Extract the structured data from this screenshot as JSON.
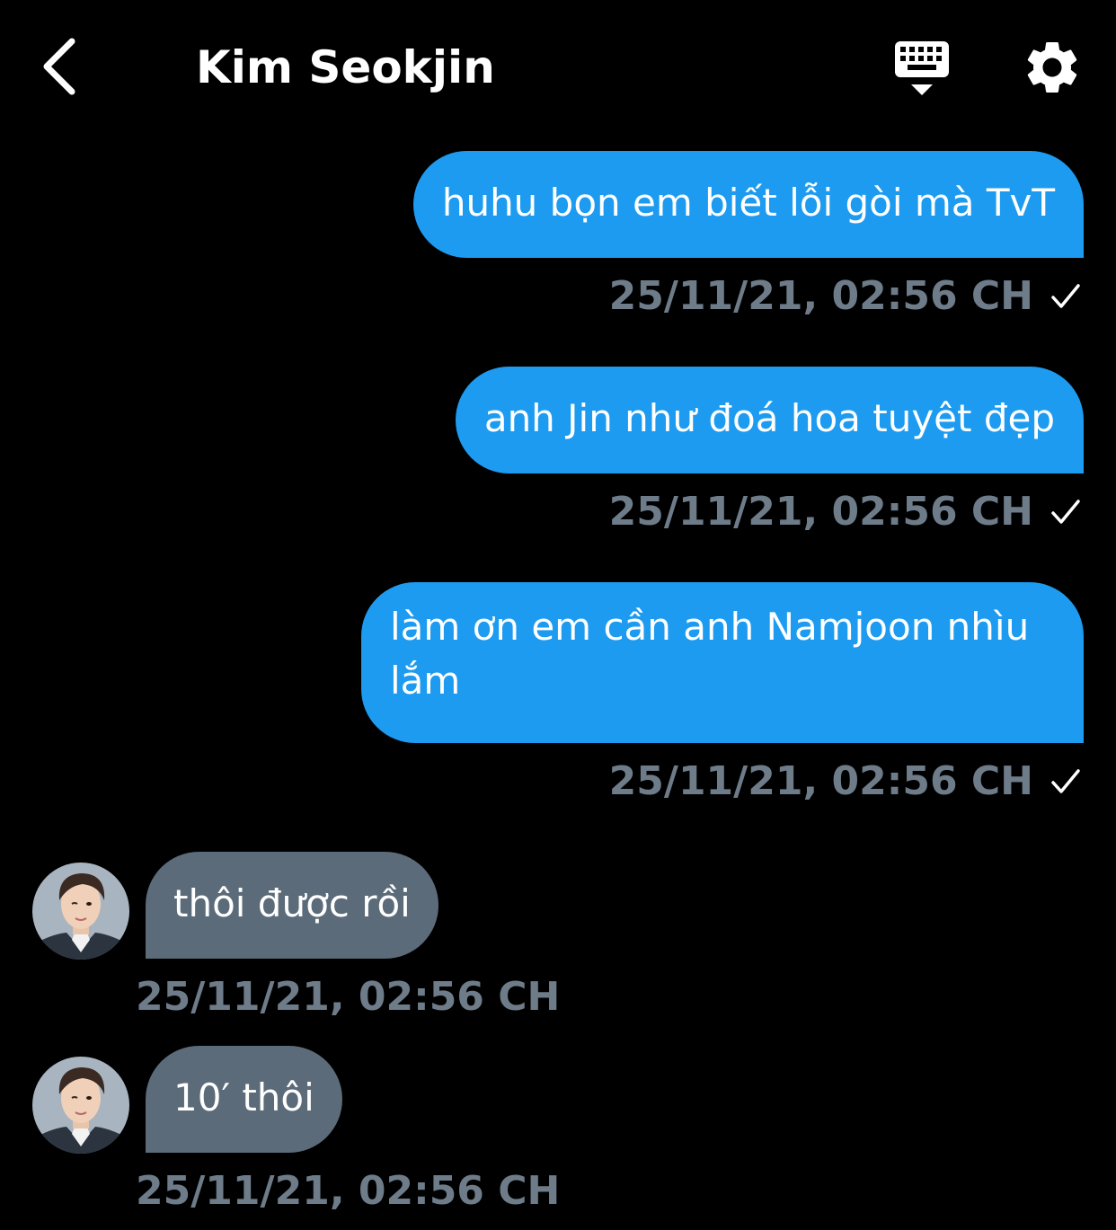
{
  "header": {
    "title": "Kim Seokjin",
    "back_icon": "chevron-left-icon",
    "keyboard_icon": "keyboard-icon",
    "settings_icon": "gear-icon"
  },
  "colors": {
    "background": "#000000",
    "outgoing_bubble": "#1d9bf0",
    "incoming_bubble": "#5b6b79",
    "timestamp": "#6e7c89"
  },
  "messages": [
    {
      "direction": "out",
      "text": "huhu bọn em biết lỗi gòi mà TvT",
      "time": "25/11/21, 02:56 CH",
      "status_icon": "checkmark-icon"
    },
    {
      "direction": "out",
      "text": "anh Jin như đoá hoa tuyệt đẹp",
      "time": "25/11/21, 02:56 CH",
      "status_icon": "checkmark-icon"
    },
    {
      "direction": "out",
      "text": "làm ơn em cần anh Namjoon nhìu lắm",
      "time": "25/11/21, 02:56 CH",
      "status_icon": "checkmark-icon"
    },
    {
      "direction": "in",
      "text": "thôi được rồi",
      "time": "25/11/21, 02:56 CH",
      "avatar_icon": "avatar"
    },
    {
      "direction": "in",
      "text": "10′ thôi",
      "time": "25/11/21, 02:56 CH",
      "avatar_icon": "avatar"
    }
  ]
}
